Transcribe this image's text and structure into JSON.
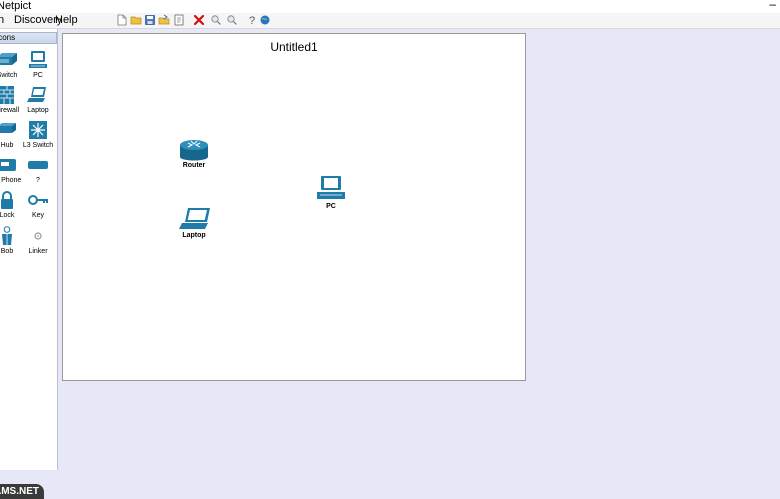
{
  "window": {
    "title": "Netpict",
    "minimize_symbol": "–"
  },
  "menu": {
    "items": [
      "n",
      "Discovery",
      "Help"
    ]
  },
  "toolbar": {
    "icons": [
      "new-file-icon",
      "open-folder-icon",
      "save-icon",
      "open-icon",
      "print-icon",
      "delete-icon",
      "zoom-in-icon",
      "zoom-out-icon",
      "help-icon",
      "globe-icon"
    ],
    "colors": {
      "delete": "#d01010",
      "globe": "#2a72c8",
      "folder": "#f0c040"
    }
  },
  "palette": {
    "header": "Icons",
    "items": [
      {
        "label": "Switch",
        "icon": "switch-icon"
      },
      {
        "label": "PC",
        "icon": "pc-icon"
      },
      {
        "label": "Firewall",
        "icon": "firewall-icon"
      },
      {
        "label": "Laptop",
        "icon": "laptop-icon"
      },
      {
        "label": "Hub",
        "icon": "hub-icon"
      },
      {
        "label": "L3 Switch",
        "icon": "l3-switch-icon"
      },
      {
        "label": "IP Phone",
        "icon": "ip-phone-icon"
      },
      {
        "label": "?",
        "icon": "unknown-device-icon"
      },
      {
        "label": "Lock",
        "icon": "lock-icon"
      },
      {
        "label": "Key",
        "icon": "key-icon"
      },
      {
        "label": "Bob",
        "icon": "bob-icon"
      },
      {
        "label": "Linker",
        "icon": "linker-icon"
      }
    ],
    "device_color": "#1f7ba8"
  },
  "canvas": {
    "title": "Untitled1",
    "nodes": [
      {
        "label": "Router",
        "icon": "router-icon"
      },
      {
        "label": "PC",
        "icon": "pc-icon"
      },
      {
        "label": "Laptop",
        "icon": "laptop-icon"
      }
    ]
  },
  "watermark": {
    "text": "AMS.NET"
  }
}
